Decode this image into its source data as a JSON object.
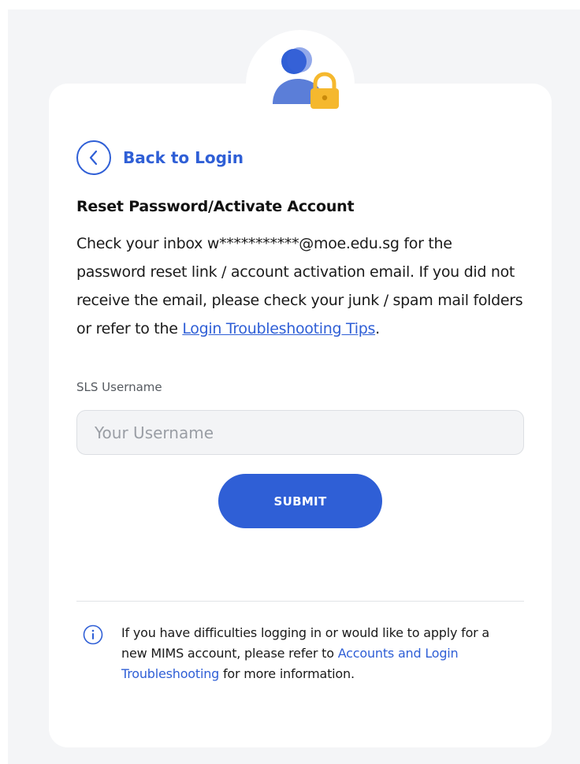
{
  "colors": {
    "accent": "#2f5fd6",
    "lock": "#f5b82e",
    "avatar_head": "#2f5fd6",
    "avatar_body": "#5b7ed8",
    "page_background": "#f4f5f7",
    "card_background": "#ffffff"
  },
  "icons": {
    "avatar": "user-lock-icon",
    "back": "chevron-left-icon",
    "info": "info-icon"
  },
  "back_link": {
    "label": "Back to Login"
  },
  "reset": {
    "title": "Reset Password/Activate Account",
    "message_before_link": "Check your inbox w***********@moe.edu.sg for the password reset link / account activation email. If you did not receive the email, please check your junk / spam mail folders or refer to the ",
    "link_label": "Login Troubleshooting Tips",
    "message_after_link": "."
  },
  "form": {
    "username_label": "SLS Username",
    "username_placeholder": "Your Username",
    "username_value": "",
    "submit_label": "SUBMIT"
  },
  "info": {
    "text_before_link": "If you have difficulties logging in or would like to apply for a new MIMS account, please refer to ",
    "link_label": "Accounts and Login Troubleshooting",
    "text_after_link": " for more information."
  }
}
